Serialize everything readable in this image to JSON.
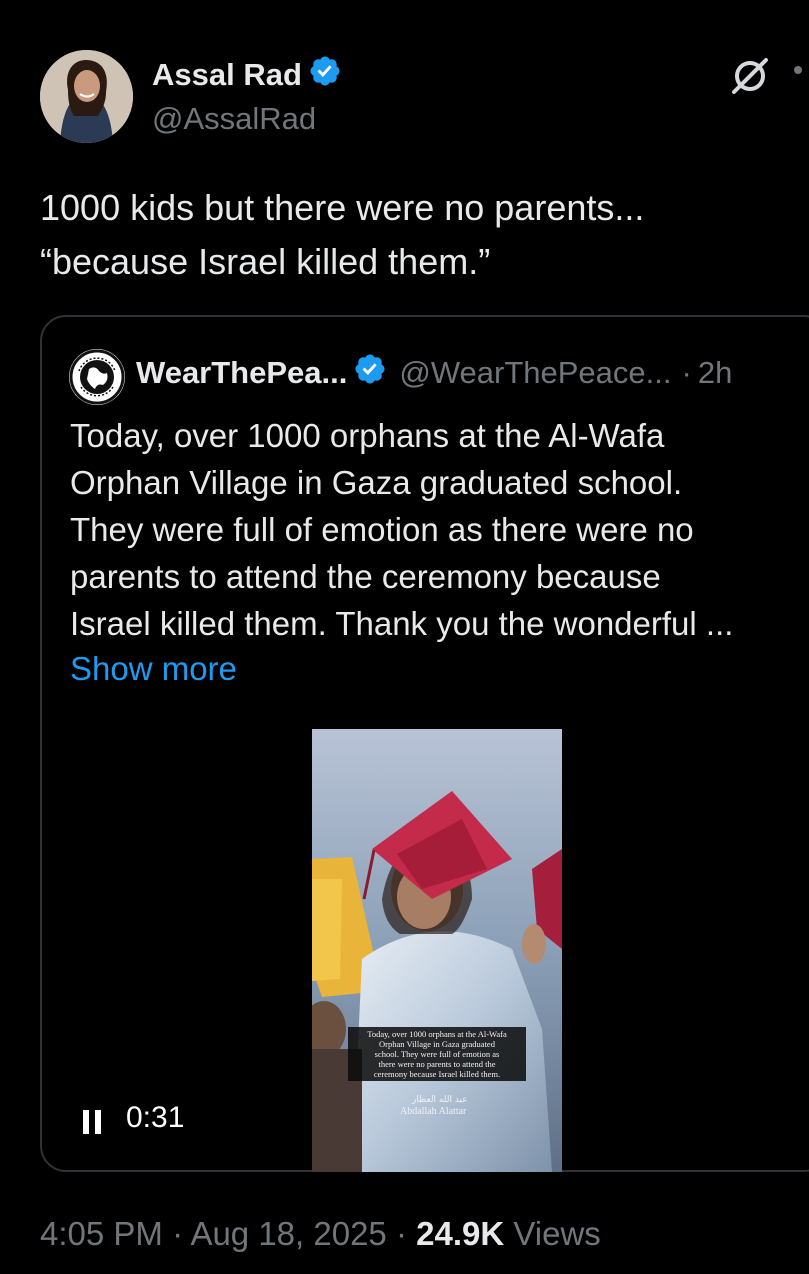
{
  "tweet": {
    "author_name": "Assal Rad",
    "author_handle": "@AssalRad",
    "text_lines": [
      "1000 kids but there were no parents...",
      "“because Israel killed them.”"
    ]
  },
  "quote": {
    "author_name": "WearThePea...",
    "author_handle": "@WearThePeace...",
    "separator": "·",
    "time": "2h",
    "text_lines": [
      "Today, over 1000 orphans at the Al-Wafa",
      "Orphan Village in Gaza graduated school.",
      "They were full of emotion as there were no",
      "parents to attend the ceremony because",
      "Israel killed them. Thank you the wonderful ..."
    ],
    "show_more": "Show more",
    "video": {
      "duration": "0:31",
      "caption_lines": [
        "Today, over 1000 orphans at the Al-Wafa",
        "Orphan Village in Gaza graduated",
        "school. They were full of emotion as",
        "there were no parents to attend the",
        "ceremony because Israel killed them."
      ],
      "credit_arabic": "عبد الله العطار",
      "credit_english": "Abdallah Alattar"
    }
  },
  "meta": {
    "time": "4:05 PM",
    "separator": "·",
    "date": "Aug 18, 2025",
    "views_count": "24.9K",
    "views_label": "Views"
  },
  "colors": {
    "background": "#000000",
    "text_primary": "#e7e9ea",
    "text_secondary": "#71767b",
    "link": "#1d9bf0",
    "verified": "#1d9bf0",
    "border": "#2f3336"
  },
  "icons": {
    "verified": "verified-badge-icon",
    "grok": "grok-icon",
    "more": "more-icon",
    "pause": "pause-icon"
  }
}
